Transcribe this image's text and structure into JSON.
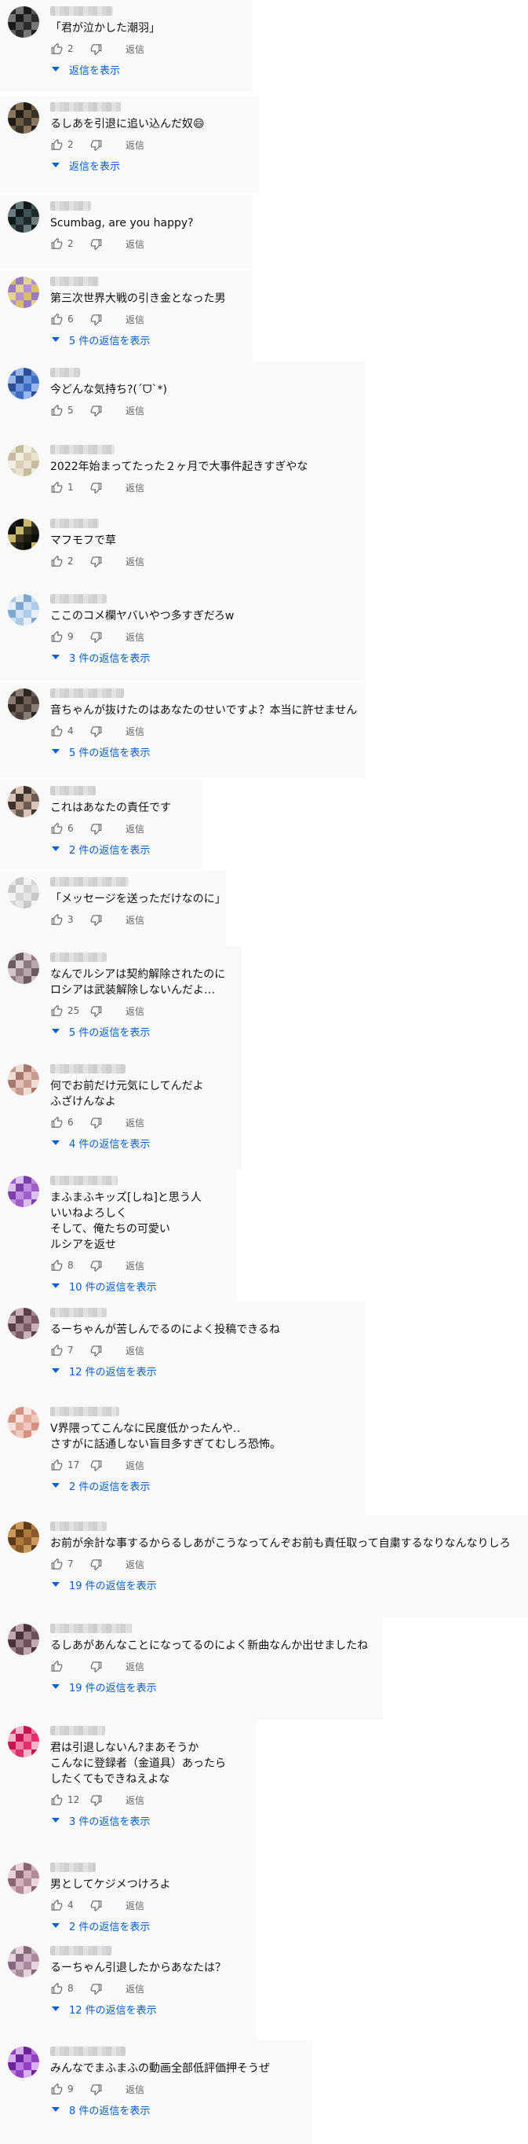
{
  "labels": {
    "reply": "返信",
    "show_replies": "返信を表示"
  },
  "comments": [
    {
      "text": "「君が泣かした潮羽」",
      "likes": "2",
      "replies": "返信を表示"
    },
    {
      "text": "るしあを引退に追い込んだ奴😄",
      "likes": "2",
      "replies": "返信を表示"
    },
    {
      "text": "Scumbag, are you happy?",
      "likes": "2",
      "replies": ""
    },
    {
      "text": "第三次世界大戦の引き金となった男",
      "likes": "6",
      "replies": "5 件の返信を表示"
    },
    {
      "text": "今どんな気持ち?(ˊᗜˋ*)",
      "likes": "5",
      "replies": ""
    },
    {
      "text": "2022年始まってたった２ヶ月で大事件起きすぎやな",
      "likes": "1",
      "replies": ""
    },
    {
      "text": "マフモフで草",
      "likes": "2",
      "replies": ""
    },
    {
      "text": "ここのコメ欄ヤバいやつ多すぎだろw",
      "likes": "9",
      "replies": "3 件の返信を表示"
    },
    {
      "text": "音ちゃんが抜けたのはあなたのせいですよ？本当に許せません",
      "likes": "4",
      "replies": "5 件の返信を表示"
    },
    {
      "text": "これはあなたの責任です",
      "likes": "6",
      "replies": "2 件の返信を表示"
    },
    {
      "text": "「メッセージを送っただけなのに」",
      "likes": "3",
      "replies": ""
    },
    {
      "text": "なんでルシアは契約解除されたのに\nロシアは武装解除しないんだよ…",
      "likes": "25",
      "replies": "5 件の返信を表示"
    },
    {
      "text": "何でお前だけ元気にしてんだよ\nふざけんなよ",
      "likes": "6",
      "replies": "4 件の返信を表示"
    },
    {
      "text": "まふまふキッズ[しね]と思う人\nいいねよろしく\nそして、俺たちの可愛い\nルシアを返せ",
      "likes": "8",
      "replies": "10 件の返信を表示"
    },
    {
      "text": "るーちゃんが苦しんでるのによく投稿できるね",
      "likes": "7",
      "replies": "12 件の返信を表示"
    },
    {
      "text": "V界隈ってこんなに民度低かったんや‥\nさすがに話通しない盲目多すぎてむしろ恐怖。",
      "likes": "17",
      "replies": "2 件の返信を表示"
    },
    {
      "text": "お前が余計な事するからるしあがこうなってんぞお前も責任取って自粛するなりなんなりしろ",
      "likes": "7",
      "replies": "19 件の返信を表示"
    },
    {
      "text": "るしあがあんなことになってるのによく新曲なんか出せましたね",
      "likes": "",
      "replies": "19 件の返信を表示"
    },
    {
      "text": "君は引退しないん?まあそうか\nこんなに登録者（金道具）あったら\nしたくてもできねえよな",
      "likes": "12",
      "replies": "3 件の返信を表示"
    },
    {
      "text": "男としてケジメつけろよ",
      "likes": "4",
      "replies": "2 件の返信を表示"
    },
    {
      "text": "るーちゃん引退したからあなたは？",
      "likes": "8",
      "replies": "12 件の返信を表示"
    },
    {
      "text": "みんなでまふまふの動画全部低評価押そうぜ",
      "likes": "9",
      "replies": "8 件の返信を表示"
    }
  ]
}
